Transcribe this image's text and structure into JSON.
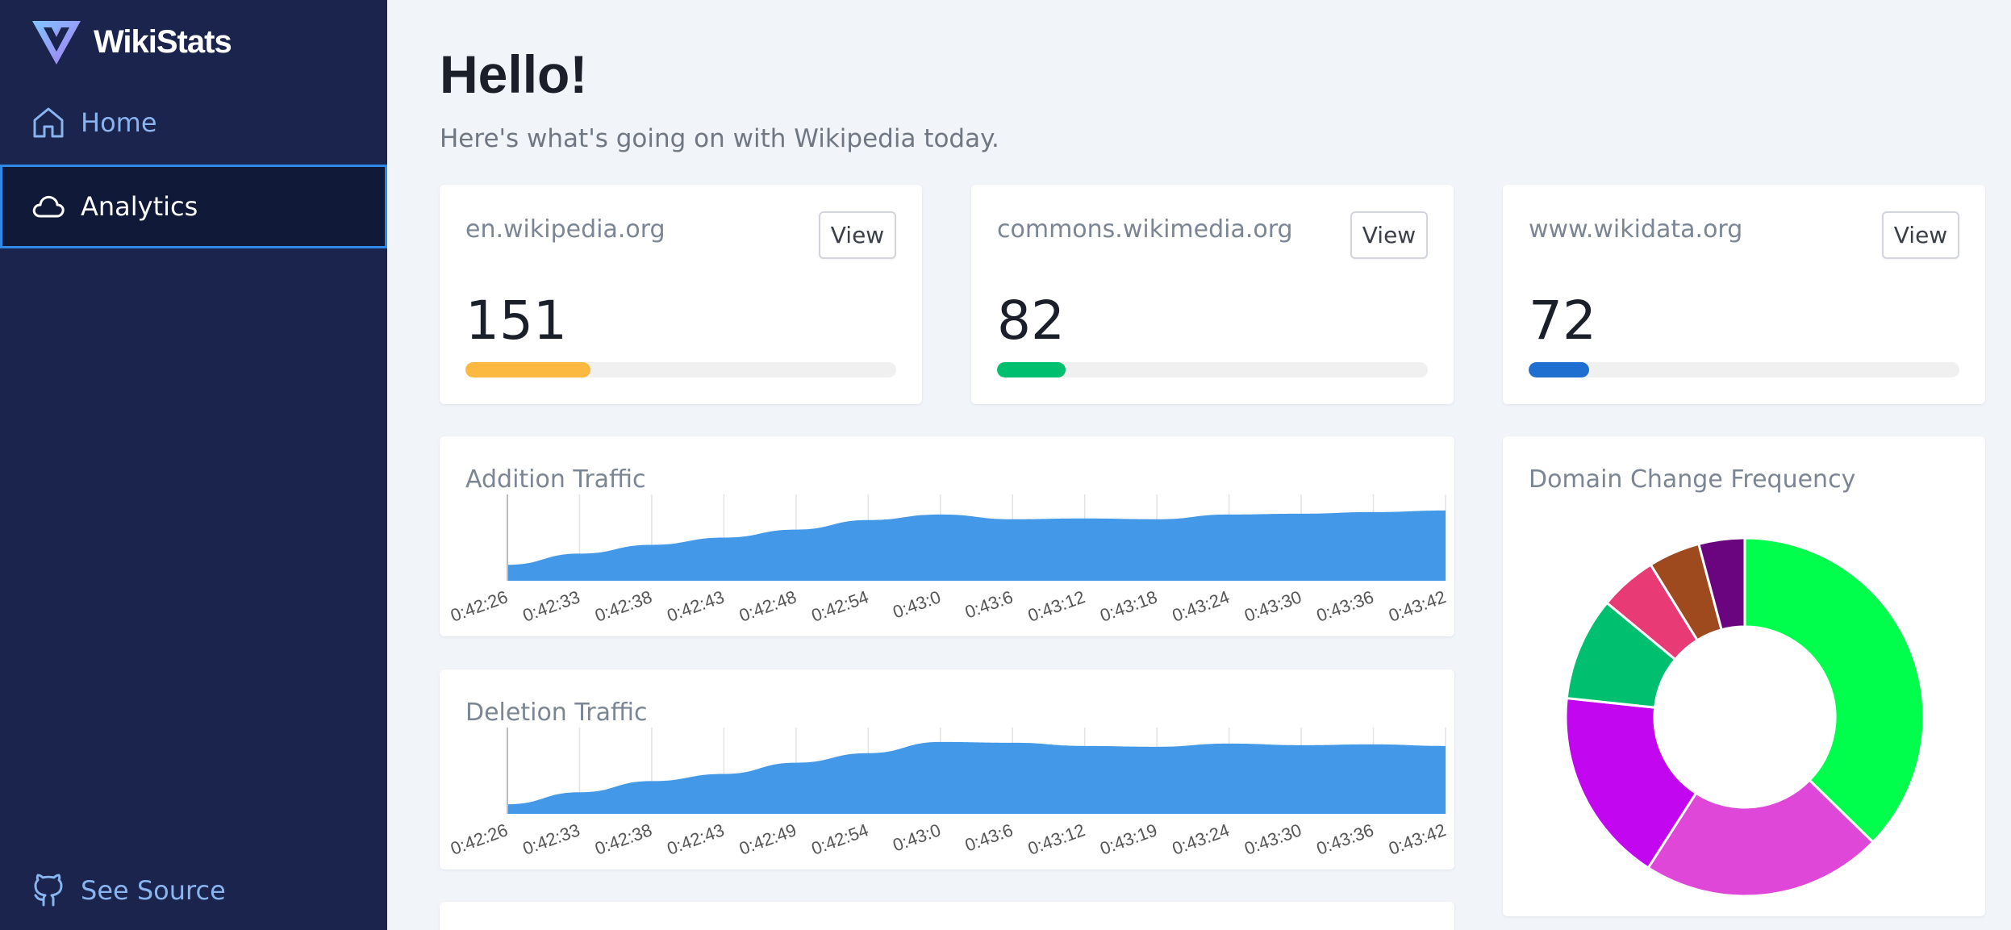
{
  "brand": {
    "name": "WikiStats"
  },
  "sidebar": {
    "items": [
      {
        "label": "Home",
        "icon": "home-icon"
      },
      {
        "label": "Analytics",
        "icon": "cloud-icon",
        "active": true
      }
    ],
    "footer": {
      "label": "See Source",
      "icon": "github-icon"
    }
  },
  "header": {
    "greeting": "Hello!",
    "subtitle": "Here's what's going on with Wikipedia today."
  },
  "stats": [
    {
      "domain": "en.wikipedia.org",
      "button": "View",
      "count": "151",
      "progress": 0.29,
      "color": "#fcb941"
    },
    {
      "domain": "commons.wikimedia.org",
      "button": "View",
      "count": "82",
      "progress": 0.16,
      "color": "#00bf6f"
    },
    {
      "domain": "www.wikidata.org",
      "button": "View",
      "count": "72",
      "progress": 0.14,
      "color": "#1f6fd0"
    }
  ],
  "chart_data": [
    {
      "type": "area",
      "title": "Addition Traffic",
      "x": [
        "0:42:26",
        "0:42:33",
        "0:42:38",
        "0:42:43",
        "0:42:48",
        "0:42:54",
        "0:43:0",
        "0:43:6",
        "0:43:12",
        "0:43:18",
        "0:43:24",
        "0:43:30",
        "0:43:36",
        "0:43:42"
      ],
      "values": [
        20,
        34,
        45,
        54,
        64,
        76,
        83,
        77,
        78,
        77,
        83,
        84,
        86,
        88
      ],
      "ylim": [
        0,
        100
      ],
      "grid": true,
      "color": "#4398e8"
    },
    {
      "type": "area",
      "title": "Deletion Traffic",
      "x": [
        "0:42:26",
        "0:42:33",
        "0:42:38",
        "0:42:43",
        "0:42:49",
        "0:42:54",
        "0:43:0",
        "0:43:6",
        "0:43:12",
        "0:43:19",
        "0:43:24",
        "0:43:30",
        "0:43:36",
        "0:43:42"
      ],
      "values": [
        12,
        27,
        41,
        50,
        64,
        76,
        90,
        89,
        85,
        84,
        88,
        86,
        87,
        85
      ],
      "ylim": [
        0,
        100
      ],
      "grid": true,
      "color": "#4398e8"
    },
    {
      "type": "pie",
      "title": "Domain Change Frequency",
      "donut": true,
      "slices": [
        {
          "value": 36,
          "color": "#00ff4c"
        },
        {
          "value": 21,
          "color": "#df47d9"
        },
        {
          "value": 17,
          "color": "#c207f0"
        },
        {
          "value": 9,
          "color": "#00c070"
        },
        {
          "value": 5,
          "color": "#e83a74"
        },
        {
          "value": 4.5,
          "color": "#9e4a1e"
        },
        {
          "value": 4,
          "color": "#6a047f"
        }
      ]
    }
  ]
}
